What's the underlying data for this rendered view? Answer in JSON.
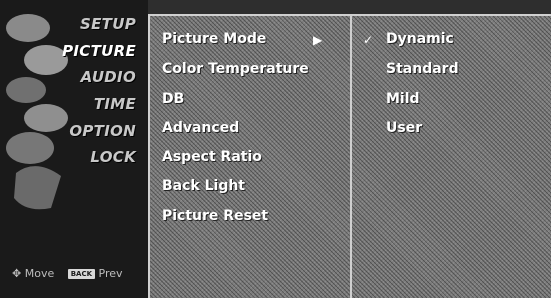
{
  "categories": [
    {
      "label": "SETUP",
      "icon": "setup-icon"
    },
    {
      "label": "PICTURE",
      "icon": "picture-icon",
      "active": true
    },
    {
      "label": "AUDIO",
      "icon": "audio-icon"
    },
    {
      "label": "TIME",
      "icon": "time-icon"
    },
    {
      "label": "OPTION",
      "icon": "option-icon"
    },
    {
      "label": "LOCK",
      "icon": "lock-icon"
    }
  ],
  "footer": {
    "move_label": "Move",
    "back_key": "BACK",
    "prev_label": "Prev"
  },
  "menu_items": [
    {
      "label": "Picture Mode",
      "has_submenu": true
    },
    {
      "label": "Color Temperature"
    },
    {
      "label": "DB"
    },
    {
      "label": "Advanced"
    },
    {
      "label": "Aspect Ratio"
    },
    {
      "label": "Back Light"
    },
    {
      "label": "Picture Reset"
    }
  ],
  "picture_mode_options": [
    {
      "label": "Dynamic",
      "selected": true
    },
    {
      "label": "Standard"
    },
    {
      "label": "Mild"
    },
    {
      "label": "User"
    }
  ]
}
